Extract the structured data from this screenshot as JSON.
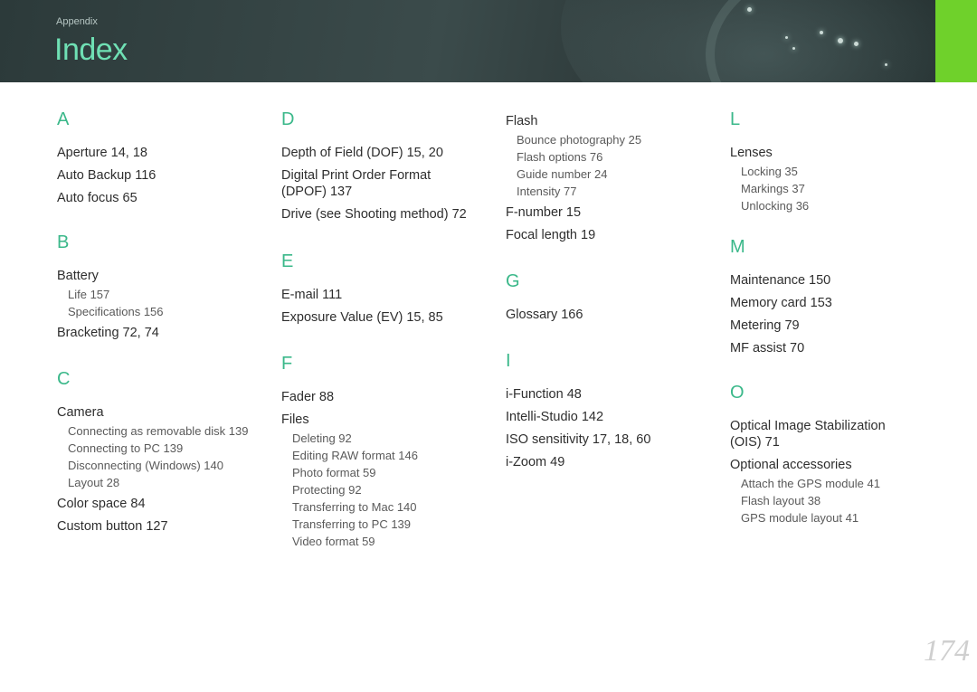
{
  "header": {
    "breadcrumb": "Appendix",
    "title": "Index"
  },
  "page_number": "174",
  "col1": {
    "A": {
      "letter": "A",
      "entries": [
        "Aperture  14, 18",
        "Auto Backup  116",
        "Auto focus  65"
      ]
    },
    "B": {
      "letter": "B",
      "battery": "Battery",
      "battery_subs": [
        "Life  157",
        "Specifications  156"
      ],
      "bracketing": "Bracketing  72, 74"
    },
    "C": {
      "letter": "C",
      "camera": "Camera",
      "camera_subs": [
        "Connecting as removable disk  139",
        "Connecting to PC  139",
        "Disconnecting (Windows)  140",
        "Layout  28"
      ],
      "color_space": "Color space  84",
      "custom_button": "Custom button  127"
    }
  },
  "col2": {
    "D": {
      "letter": "D",
      "dof": "Depth of Field (DOF)  15, 20",
      "dpof_line1": "Digital Print Order Format",
      "dpof_line2": "(DPOF)  137",
      "drive": "Drive (see Shooting method)  72"
    },
    "E": {
      "letter": "E",
      "entries": [
        "E-mail  111",
        "Exposure Value (EV)  15, 85"
      ]
    },
    "F": {
      "letter": "F",
      "fader": "Fader  88",
      "files": "Files",
      "files_subs": [
        "Deleting  92",
        "Editing RAW format  146",
        "Photo format  59",
        "Protecting  92",
        "Transferring to Mac  140",
        "Transferring to PC  139",
        "Video format  59"
      ]
    }
  },
  "col3": {
    "flash": "Flash",
    "flash_subs": [
      "Bounce photography  25",
      "Flash options  76",
      "Guide number  24",
      "Intensity  77"
    ],
    "fnumber": "F-number  15",
    "focal": "Focal length  19",
    "G": {
      "letter": "G",
      "entries": [
        "Glossary  166"
      ]
    },
    "I": {
      "letter": "I",
      "entries": [
        "i-Function  48",
        "Intelli-Studio  142",
        "ISO sensitivity  17, 18, 60",
        "i-Zoom  49"
      ]
    }
  },
  "col4": {
    "L": {
      "letter": "L",
      "lenses": "Lenses",
      "lenses_subs": [
        "Locking  35",
        "Markings  37",
        "Unlocking  36"
      ]
    },
    "M": {
      "letter": "M",
      "entries": [
        "Maintenance  150",
        "Memory card  153",
        "Metering  79",
        "MF assist  70"
      ]
    },
    "O": {
      "letter": "O",
      "ois_line1": "Optical Image Stabilization",
      "ois_line2": "(OIS)  71",
      "optional": "Optional accessories",
      "optional_subs": [
        "Attach the GPS module  41",
        "Flash layout  38",
        "GPS module layout  41"
      ]
    }
  },
  "colors": {
    "accent": "#3bb88a",
    "title": "#6fe0b4",
    "tab": "#6fd12b",
    "header": "#344444"
  }
}
